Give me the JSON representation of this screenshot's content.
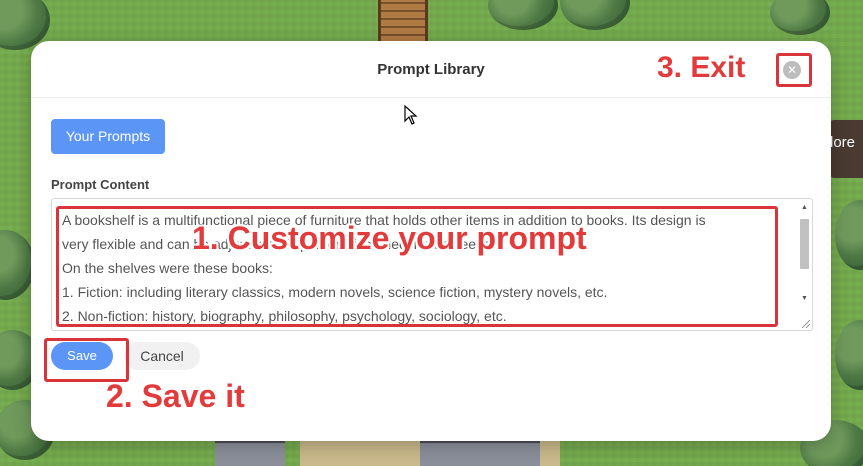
{
  "modal": {
    "title": "Prompt Library",
    "close_icon": "close-circle-icon",
    "tab_label": "Your Prompts",
    "field_label": "Prompt Content",
    "content_lines": [
      "A bookshelf is a multifunctional piece of furniture that holds other items in addition to books. Its design is",
      "very flexible and can be adjusted to fit personalized decoration needs.",
      "On the shelves were these books:",
      "1. Fiction: including literary classics, modern novels, science fiction, mystery novels, etc.",
      "2. Non-fiction: history, biography, philosophy, psychology, sociology, etc."
    ],
    "save_label": "Save",
    "cancel_label": "Cancel"
  },
  "annotations": {
    "customize": "1. Customize your prompt",
    "save": "2. Save it",
    "exit": "3. Exit"
  },
  "background": {
    "side_panel_text": "lore"
  },
  "colors": {
    "accent": "#5b96f7",
    "annotation": "#e23b3b"
  }
}
